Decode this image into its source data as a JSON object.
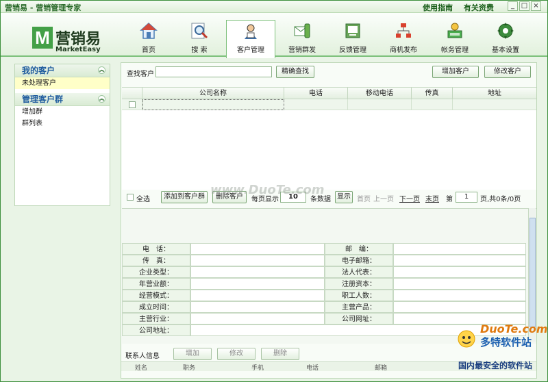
{
  "app": {
    "title": "营销易 - 营销管理专家"
  },
  "title_links": [
    "使用指南",
    "有关资费"
  ],
  "window_buttons": [
    "_",
    "□",
    "×"
  ],
  "logo": {
    "letter": "M",
    "cn": "营销易",
    "en": "MarketEasy"
  },
  "nav": [
    {
      "label": "首页",
      "icon": "home-icon"
    },
    {
      "label": "搜  索",
      "icon": "search-icon"
    },
    {
      "label": "客户管理",
      "icon": "customer-icon"
    },
    {
      "label": "营销群发",
      "icon": "mail-icon"
    },
    {
      "label": "反馈管理",
      "icon": "feedback-icon"
    },
    {
      "label": "商机发布",
      "icon": "network-icon"
    },
    {
      "label": "帐务管理",
      "icon": "account-icon"
    },
    {
      "label": "基本设置",
      "icon": "settings-icon"
    }
  ],
  "active_nav": "客户管理",
  "sidebar": {
    "my_customers": {
      "title": "我的客户",
      "items": [
        "未处理客户"
      ]
    },
    "groups": {
      "title": "管理客户群",
      "items": [
        "增加群",
        "群列表"
      ]
    }
  },
  "search": {
    "label": "查找客户",
    "value": "",
    "button": "精确查找"
  },
  "actions": {
    "add": "增加客户",
    "edit": "修改客户"
  },
  "grid": {
    "columns": [
      "公司名称",
      "电话",
      "移动电话",
      "传真",
      "地址"
    ]
  },
  "pager": {
    "select_all": "全选",
    "add_to_group": "添加到客户群",
    "delete": "删除客户",
    "per_page_label": "每页显示",
    "per_page": "10",
    "per_page_unit": "条数据",
    "show": "显示",
    "first": "首页",
    "prev": "上一页",
    "next": "下一页",
    "last": "末页",
    "page_label": "第",
    "page": "1",
    "summary": "页,共0条/0页"
  },
  "detail": {
    "left": [
      "电　话：",
      "传　真：",
      "企业类型：",
      "年营业额：",
      "经营模式：",
      "成立时间：",
      "主营行业：",
      "公司地址："
    ],
    "right": [
      "邮　编：",
      "电子邮箱：",
      "法人代表：",
      "注册资本：",
      "职工人数：",
      "主营产品：",
      "公司网址："
    ]
  },
  "contact": {
    "label": "联系人信息",
    "add": "增加",
    "edit": "修改",
    "delete": "删除"
  },
  "contact_columns": [
    "姓名",
    "职务",
    "手机",
    "电话",
    "邮箱"
  ],
  "watermarks": {
    "center": "www.DuoTe.com",
    "site": "DuoTe.com",
    "brand": "多特软件站",
    "slogan": "国内最安全的软件站"
  },
  "colors": {
    "accent": "#43a047",
    "link": "#1f5c9e",
    "selected_row": "#ffffc8"
  }
}
